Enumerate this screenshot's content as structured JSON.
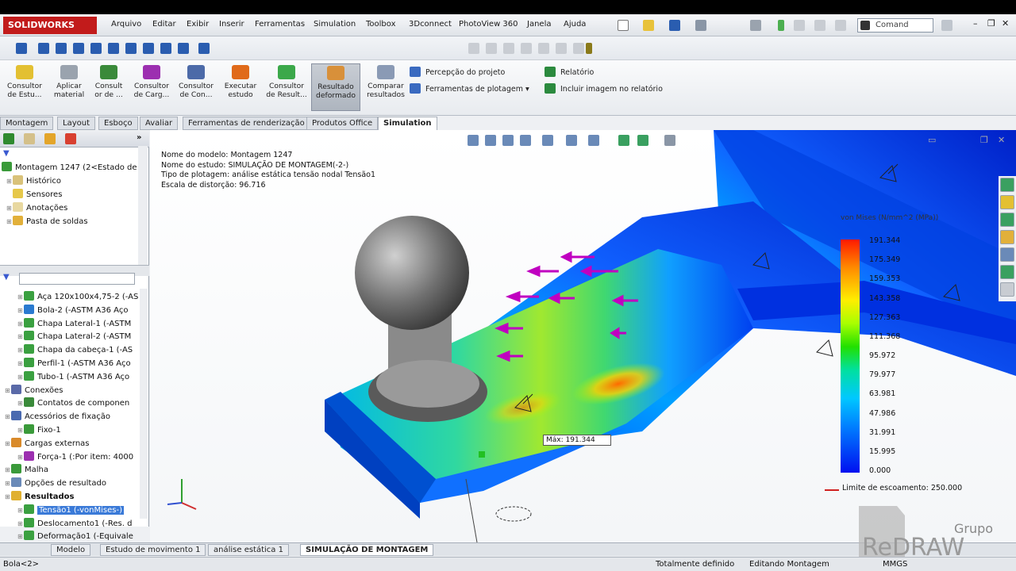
{
  "menubar": {
    "app_name": "SOLIDWORKS",
    "items": [
      "Arquivo",
      "Editar",
      "Exibir",
      "Inserir",
      "Ferramentas",
      "Simulation",
      "Toolbox",
      "3Dconnect",
      "PhotoView 360",
      "Janela",
      "Ajuda"
    ],
    "command_search_placeholder": "Comand"
  },
  "ribbon": {
    "buttons": [
      {
        "label1": "Consultor",
        "label2": "de Estu..."
      },
      {
        "label1": "Aplicar",
        "label2": "material"
      },
      {
        "label1": "Consult",
        "label2": "or de ..."
      },
      {
        "label1": "Consultor",
        "label2": "de Carg..."
      },
      {
        "label1": "Consultor",
        "label2": "de Con..."
      },
      {
        "label1": "Executar",
        "label2": "estudo"
      },
      {
        "label1": "Consultor",
        "label2": "de Result..."
      },
      {
        "label1": "Resultado",
        "label2": "deformado"
      },
      {
        "label1": "Comparar",
        "label2": "resultados"
      }
    ],
    "small": [
      "Percepção do projeto",
      "Ferramentas de plotagem",
      "Relatório",
      "Incluir imagem no relatório"
    ]
  },
  "cm_tabs": [
    "Montagem",
    "Layout",
    "Esboço",
    "Avaliar",
    "Ferramentas de renderização",
    "Produtos Office",
    "Simulation"
  ],
  "tree_top": {
    "root": "Montagem 1247  (2<Estado de",
    "items": [
      "Histórico",
      "Sensores",
      "Anotações",
      "Pasta de soldas"
    ]
  },
  "tree_study": [
    {
      "label": "Aça 120x100x4,75-2 (-AS",
      "indent": 1
    },
    {
      "label": "Bola-2 (-ASTM A36 Aço",
      "indent": 1
    },
    {
      "label": "Chapa Lateral-1 (-ASTM",
      "indent": 1
    },
    {
      "label": "Chapa Lateral-2 (-ASTM",
      "indent": 1
    },
    {
      "label": "Chapa da cabeça-1 (-AS",
      "indent": 1
    },
    {
      "label": "Perfil-1 (-ASTM A36 Aço",
      "indent": 1
    },
    {
      "label": "Tubo-1 (-ASTM A36 Aço",
      "indent": 1
    },
    {
      "label": "Conexões",
      "indent": 0
    },
    {
      "label": "Contatos de componen",
      "indent": 1
    },
    {
      "label": "Acessórios de fixação",
      "indent": 0
    },
    {
      "label": "Fixo-1",
      "indent": 1
    },
    {
      "label": "Cargas externas",
      "indent": 0
    },
    {
      "label": "Força-1 (:Por item: 4000",
      "indent": 1
    },
    {
      "label": "Malha",
      "indent": 0
    },
    {
      "label": "Opções de resultado",
      "indent": 0
    },
    {
      "label": "Resultados",
      "indent": 0
    },
    {
      "label": "Tensão1 (-vonMises-)",
      "indent": 1
    },
    {
      "label": "Deslocamento1 (-Res. d",
      "indent": 1
    },
    {
      "label": "Deformação1 (-Equivale",
      "indent": 1
    }
  ],
  "viewport": {
    "info": [
      "Nome do modelo: Montagem 1247",
      "Nome do estudo: SIMULAÇÃO DE MONTAGEM(-2-)",
      "Tipo de plotagem: análise estática tensão nodal Tensão1",
      "Escala de distorção: 96.716"
    ],
    "legend_title": "von Mises (N/mm^2 (MPa))",
    "legend_values": [
      "191.344",
      "175.349",
      "159.353",
      "143.358",
      "127.363",
      "111.368",
      "95.972",
      "79.977",
      "63.981",
      "47.986",
      "31.991",
      "15.995",
      "0.000"
    ],
    "yield_label": "Limite de escoamento: 250.000",
    "max_label": "Máx:  191.344"
  },
  "bottom_tabs": [
    "Modelo",
    "Estudo de movimento 1",
    "análise estática 1",
    "SIMULAÇÃO DE MONTAGEM"
  ],
  "status": {
    "left": "Bola<2>",
    "state1": "Totalmente definido",
    "state2": "Editando Montagem",
    "units": "MMGS"
  },
  "branding": {
    "line1": "Grupo",
    "line2": "ReDRAW"
  }
}
